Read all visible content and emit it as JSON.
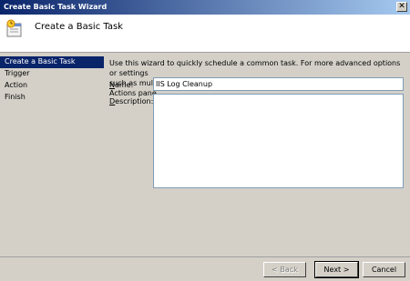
{
  "window": {
    "title": "Create Basic Task Wizard"
  },
  "header": {
    "heading": "Create a Basic Task",
    "icon": "task-clock-icon"
  },
  "sidebar": {
    "items": [
      {
        "label": "Create a Basic Task",
        "active": true
      },
      {
        "label": "Trigger"
      },
      {
        "label": "Action"
      },
      {
        "label": "Finish"
      }
    ]
  },
  "main": {
    "description_line1": "Use this wizard to quickly schedule a common task.  For more advanced options or settings",
    "description_line2": "such as multiple task actions or triggers, use the Create Task command in the Actions pane.",
    "name_label_prefix": "N",
    "name_label_rest": "ame:",
    "name_value": "IIS Log Cleanup",
    "description_label_prefix": "D",
    "description_label_rest": "escription:",
    "description_value": ""
  },
  "buttons": {
    "back_label": "< Back",
    "next_label": "Next >",
    "cancel_label": "Cancel"
  },
  "colors": {
    "selection": "#0a246a",
    "dialog": "#d4d0c8",
    "title_gradient_end": "#a6caf0"
  }
}
